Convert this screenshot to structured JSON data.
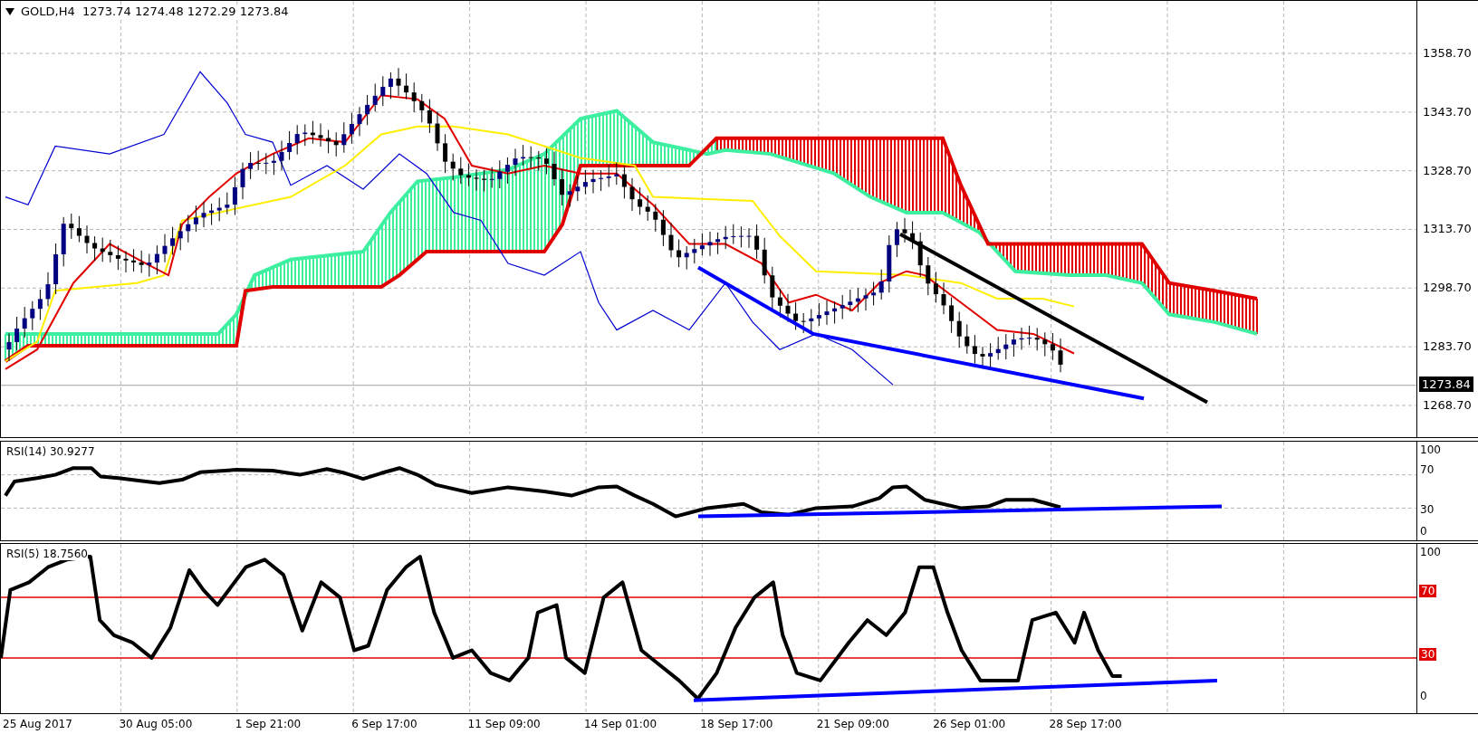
{
  "main_pane": {
    "header": "GOLD,H4  1273.74 1274.48 1272.29 1273.84",
    "price_axis": [
      "1358.70",
      "1343.70",
      "1328.70",
      "1313.70",
      "1298.70",
      "1283.70",
      "1268.70"
    ],
    "current_price": "1273.84"
  },
  "rsi14_pane": {
    "label": "RSI(14) 30.9277",
    "axis": [
      {
        "label": "100",
        "kind": "plain"
      },
      {
        "label": "70",
        "kind": "plain"
      },
      {
        "label": "30",
        "kind": "plain"
      },
      {
        "label": "0",
        "kind": "plain"
      }
    ]
  },
  "rsi5_pane": {
    "label": "RSI(5) 18.7560",
    "axis": [
      {
        "label": "100",
        "kind": "plain"
      },
      {
        "label": "70",
        "kind": "level"
      },
      {
        "label": "30",
        "kind": "level"
      },
      {
        "label": "0",
        "kind": "plain"
      }
    ]
  },
  "time_axis": [
    "25 Aug 2017",
    "30 Aug 05:00",
    "1 Sep 21:00",
    "6 Sep 17:00",
    "11 Sep 09:00",
    "14 Sep 01:00",
    "18 Sep 17:00",
    "21 Sep 09:00",
    "26 Sep 01:00",
    "28 Sep 17:00"
  ]
}
